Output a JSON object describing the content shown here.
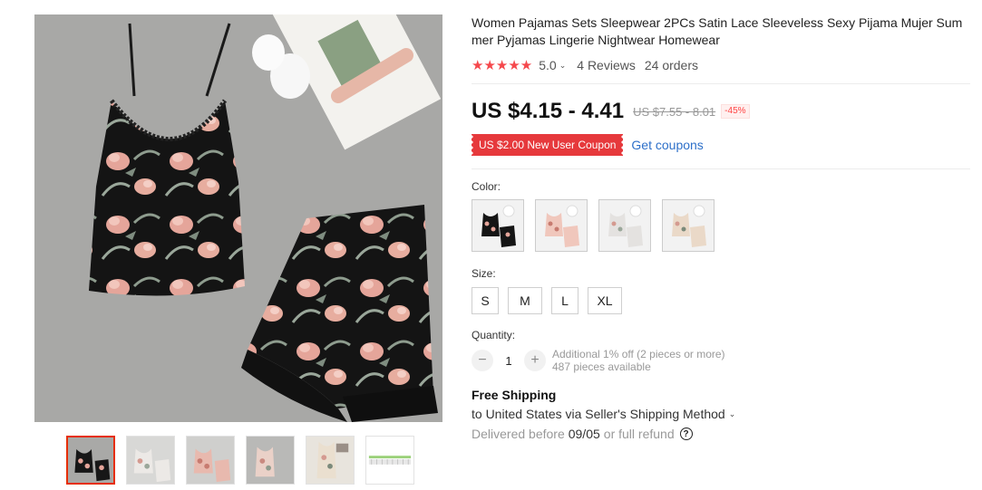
{
  "product": {
    "title": "Women Pajamas Sets Sleepwear 2PCs Satin Lace Sleeveless Sexy Pijama Mujer Summer Pyjamas Lingerie Nightwear Homewear",
    "rating": "5.0",
    "stars": "★★★★★",
    "chevron": "⌄",
    "reviews": "4 Reviews",
    "orders": "24 orders"
  },
  "price": {
    "current": "US $4.15 - 4.41",
    "original": "US $7.55 - 8.01",
    "discount": "-45%"
  },
  "coupon": {
    "label": "US $2.00 New User Coupon",
    "link": "Get coupons"
  },
  "color": {
    "label": "Color:",
    "options": [
      "black-floral",
      "pink-floral",
      "grey-floral",
      "beige-floral"
    ]
  },
  "size": {
    "label": "Size:",
    "options": [
      "S",
      "M",
      "L",
      "XL"
    ]
  },
  "quantity": {
    "label": "Quantity:",
    "value": "1",
    "minus": "−",
    "plus": "+",
    "note1": "Additional 1% off (2 pieces or more)",
    "note2": "487 pieces available"
  },
  "shipping": {
    "title": "Free Shipping",
    "to": "to United States via Seller's Shipping Method",
    "delivery_prefix": "Delivered before",
    "delivery_date": "09/05",
    "delivery_suffix": "or full refund",
    "help": "?"
  },
  "gallery": {
    "thumbnails": [
      "black-floral",
      "grey-floral",
      "pink-floral",
      "pink-floral-2",
      "beige-floral",
      "size-chart"
    ],
    "active_index": 0
  },
  "colors": {
    "accent": "#e6393c",
    "star": "#f5484c",
    "link": "#2e70c9"
  }
}
